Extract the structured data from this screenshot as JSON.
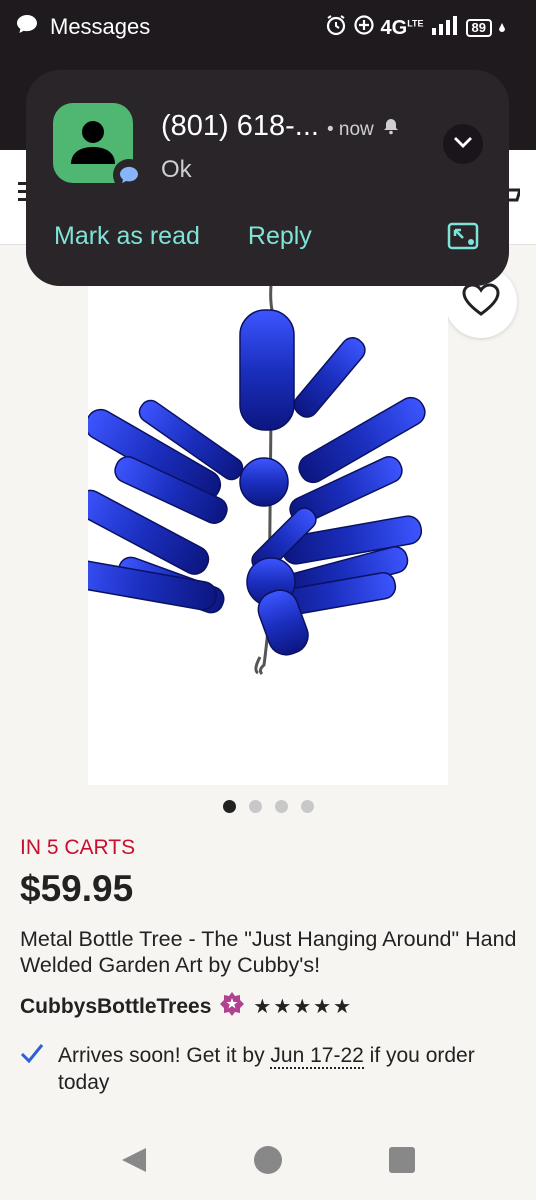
{
  "status_bar": {
    "app_name": "Messages",
    "network": "4G",
    "network_sup": "LTE",
    "battery": "89"
  },
  "notification": {
    "sender": "(801) 618-...",
    "time": "• now",
    "message": "Ok",
    "actions": {
      "mark_read": "Mark as read",
      "reply": "Reply"
    }
  },
  "product": {
    "in_carts": "IN 5 CARTS",
    "price": "$59.95",
    "title": "Metal Bottle Tree - The \"Just Hanging Around\" Hand Welded Garden Art by Cubby's!",
    "shop_name": "CubbysBottleTrees",
    "stars": "★★★★★",
    "delivery_prefix": "Arrives soon! Get it by",
    "delivery_date": "Jun 17-22",
    "delivery_suffix": "if you order today",
    "image_count": 4,
    "active_image": 1
  },
  "colors": {
    "accent_red": "#c8102e",
    "notification_bg": "#2a2528",
    "notification_action": "#7fe3d8",
    "avatar_green": "#4fb772",
    "star_seller_purple": "#b0428f",
    "bottle_blue": "#1b2fbf"
  }
}
